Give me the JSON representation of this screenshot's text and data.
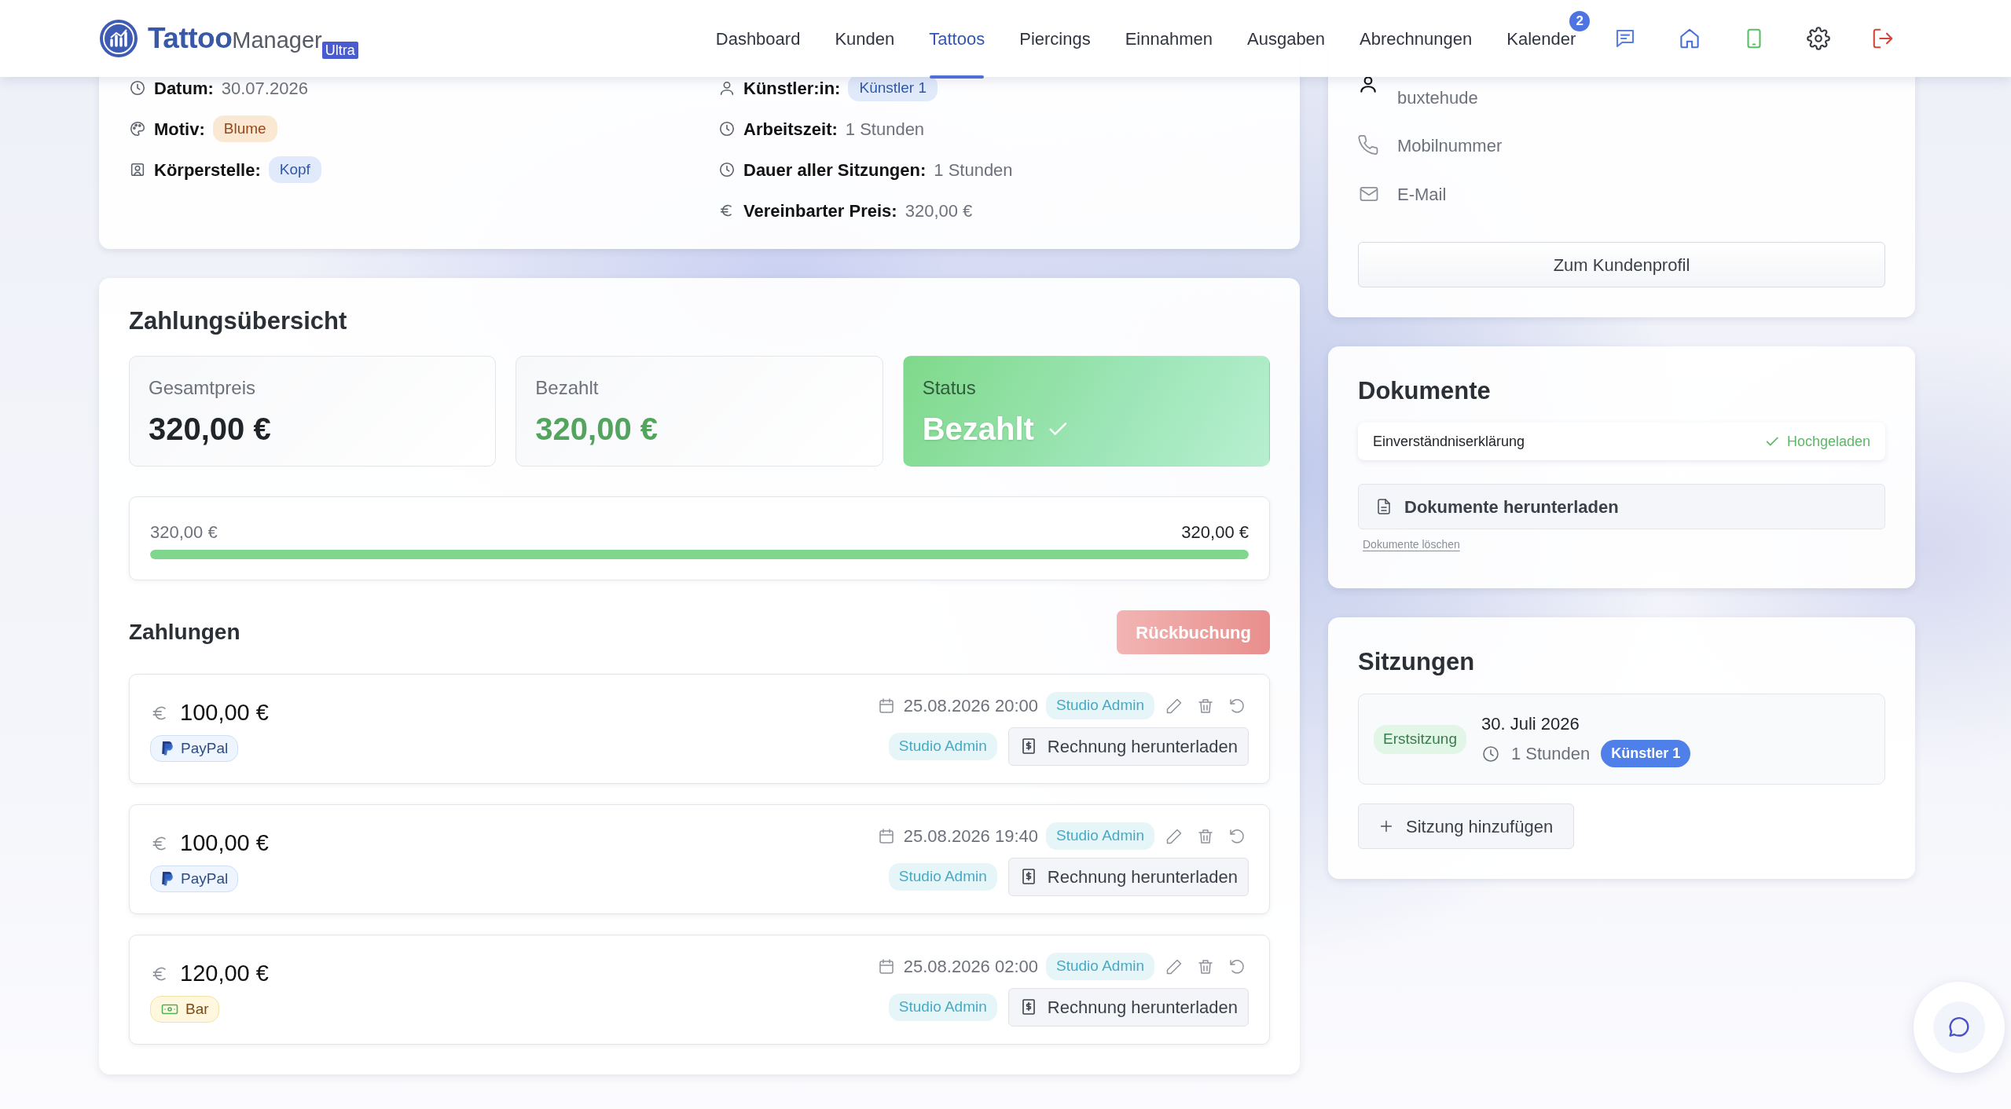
{
  "navbar": {
    "brand": "Tattoo",
    "brand_suffix": "Manager",
    "edition": "Ultra",
    "items": [
      {
        "label": "Dashboard",
        "selected": false
      },
      {
        "label": "Kunden",
        "selected": false
      },
      {
        "label": "Tattoos",
        "selected": true
      },
      {
        "label": "Piercings",
        "selected": false
      },
      {
        "label": "Einnahmen",
        "selected": false
      },
      {
        "label": "Ausgaben",
        "selected": false
      },
      {
        "label": "Abrechnungen",
        "selected": false
      },
      {
        "label": "Kalender",
        "selected": false,
        "badge": "2"
      }
    ]
  },
  "tattoo_details": {
    "left": [
      {
        "kind": "date",
        "label": "Datum:",
        "value": "30.07.2026"
      },
      {
        "kind": "motif",
        "label": "Motiv:",
        "value": "Blume",
        "tag": true,
        "color": "#fbe8d2"
      },
      {
        "kind": "body_part",
        "label": "Körperstelle:",
        "value": "Kopf",
        "tag": true,
        "color": "#e1eafb"
      }
    ],
    "right": [
      {
        "kind": "artist",
        "label": "Künstler:in:",
        "value": "Künstler 1",
        "tag": true,
        "color": "#e1eafb"
      },
      {
        "kind": "time",
        "label": "Arbeitszeit:",
        "value": "1 Stunden"
      },
      {
        "kind": "time",
        "label": "Dauer aller Sitzungen:",
        "value": "1 Stunden"
      },
      {
        "kind": "price",
        "label": "Vereinbarter Preis:",
        "value": "320,00 €"
      }
    ]
  },
  "payment_summary": {
    "title": "Zahlungsübersicht",
    "stats": [
      {
        "kind": "total",
        "label": "Gesamtpreis",
        "value": "320,00 €"
      },
      {
        "kind": "paid",
        "label": "Bezahlt",
        "value": "320,00 €"
      },
      {
        "kind": "status",
        "label": "Status",
        "value": "Bezahlt"
      }
    ],
    "progress": {
      "paid": "320,00 €",
      "total": "320,00 €",
      "level": 1
    }
  },
  "payments": {
    "title": "Zahlungen",
    "reverse_button": {
      "label": "Rückbuchung",
      "disabled": true
    },
    "items": [
      {
        "amount": "100,00 €",
        "method": "PayPal",
        "kind": "paypal",
        "date": "25.08.2026 20:00",
        "created_by": "Studio Admin",
        "invoiced_by": "Studio Admin",
        "download": "Rechnung herunterladen"
      },
      {
        "amount": "100,00 €",
        "method": "PayPal",
        "kind": "paypal",
        "date": "25.08.2026 19:40",
        "created_by": "Studio Admin",
        "invoiced_by": "Studio Admin",
        "download": "Rechnung herunterladen"
      },
      {
        "amount": "120,00 €",
        "method": "Bar",
        "kind": "cash",
        "date": "25.08.2026 02:00",
        "created_by": "Studio Admin",
        "invoiced_by": "Studio Admin",
        "download": "Rechnung herunterladen"
      }
    ]
  },
  "customer": {
    "city": "buxtehude",
    "phone": "Mobilnummer",
    "email": "E-Mail",
    "profile_button": "Zum Kundenprofil"
  },
  "documents": {
    "title": "Dokumente",
    "items": [
      {
        "name": "Einverständniserklärung",
        "status": "Hochgeladen",
        "uploaded": true
      }
    ],
    "download_button": "Dokumente herunterladen",
    "delete_link": "Dokumente löschen"
  },
  "sessions": {
    "title": "Sitzungen",
    "items": [
      {
        "type": "Erstsitzung",
        "date": "30. Juli 2026",
        "duration": "1 Stunden",
        "artist": "Künstler 1"
      }
    ],
    "add_button": "Sitzung hinzufügen"
  }
}
